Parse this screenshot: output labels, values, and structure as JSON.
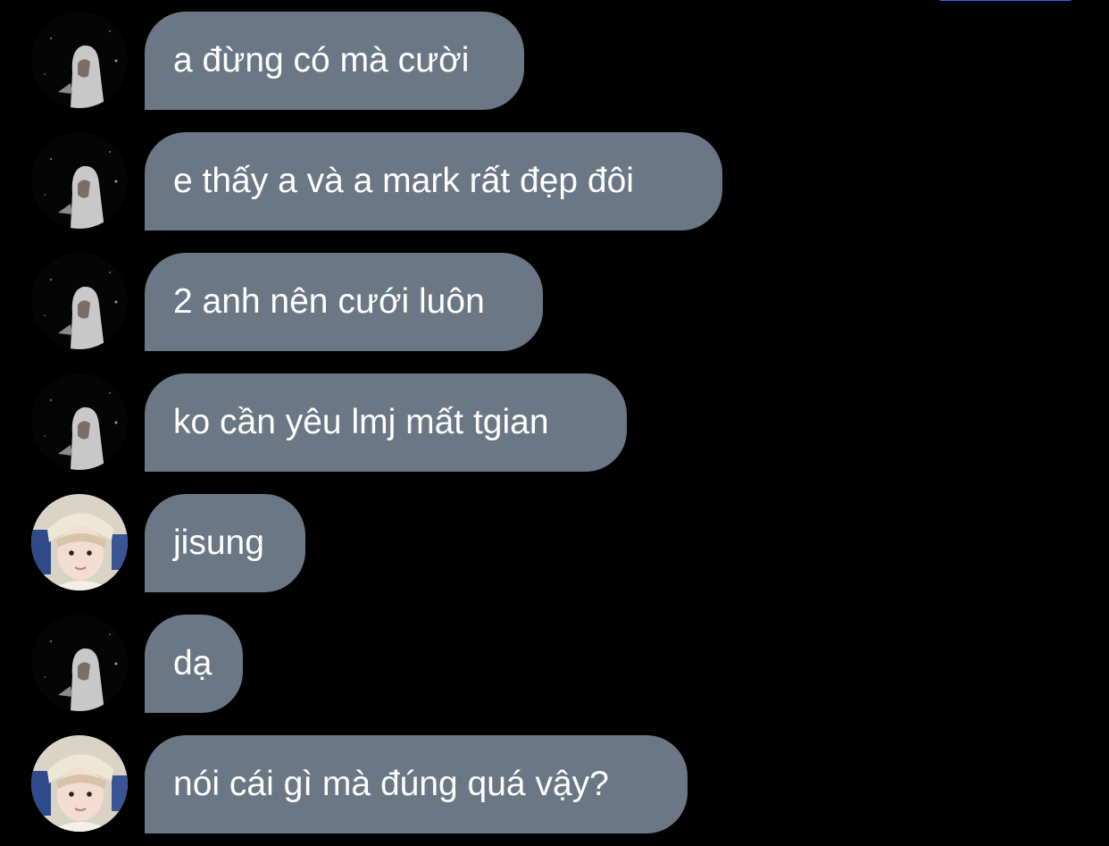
{
  "colors": {
    "background": "#000000",
    "bubble": "#6b7785",
    "text": "#ffffff",
    "accent": "#2d6cdf"
  },
  "messages": [
    {
      "sender": "friend",
      "text": "a đừng có mà cười"
    },
    {
      "sender": "friend",
      "text": "e thấy a và a mark rất đẹp đôi"
    },
    {
      "sender": "friend",
      "text": "2 anh nên cưới luôn"
    },
    {
      "sender": "friend",
      "text": "ko cần yêu lmj mất tgian"
    },
    {
      "sender": "self",
      "text": "jisung"
    },
    {
      "sender": "friend",
      "text": "dạ"
    },
    {
      "sender": "self",
      "text": "nói cái gì mà đúng quá vậy?"
    }
  ]
}
